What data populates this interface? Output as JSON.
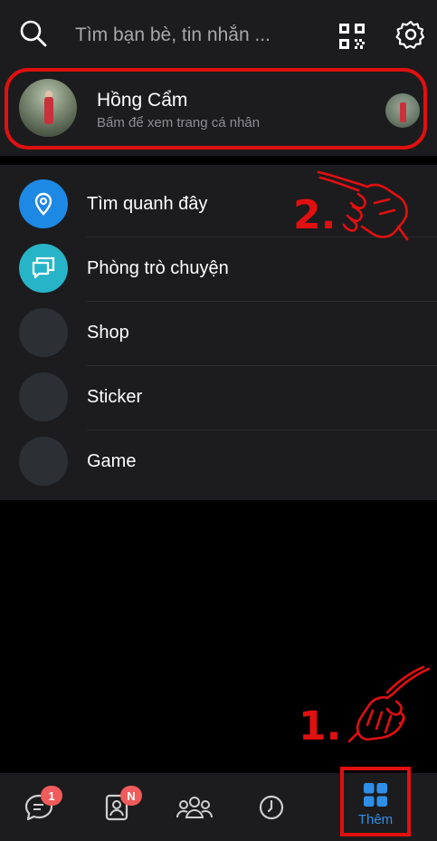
{
  "search": {
    "placeholder": "Tìm bạn bè, tin nhắn ..."
  },
  "profile": {
    "name": "Hồng Cẩm",
    "subtitle": "Bấm để xem trang cá nhân"
  },
  "menu": {
    "items": [
      {
        "label": "Tìm quanh đây",
        "icon": "location-pin-icon",
        "color": "#1e88e5"
      },
      {
        "label": "Phòng trò chuyện",
        "icon": "chat-rooms-icon",
        "color": "#28b4c8"
      },
      {
        "label": "Shop",
        "icon": "shop-icon",
        "color": "#2c3035"
      },
      {
        "label": "Sticker",
        "icon": "sticker-icon",
        "color": "#2c3035"
      },
      {
        "label": "Game",
        "icon": "game-icon",
        "color": "#2c3035"
      }
    ]
  },
  "annotations": {
    "step1": "1.",
    "step2": "2."
  },
  "bottom_nav": {
    "tabs": [
      {
        "name": "messages",
        "icon": "chat-bubble-icon",
        "badge": "1"
      },
      {
        "name": "contacts",
        "icon": "contact-card-icon",
        "badge": "N"
      },
      {
        "name": "groups",
        "icon": "group-icon"
      },
      {
        "name": "timeline",
        "icon": "clock-icon"
      },
      {
        "name": "more",
        "icon": "grid-icon",
        "label": "Thêm",
        "active": true
      }
    ]
  },
  "colors": {
    "accent": "#2f8fe8",
    "highlight": "#e01010",
    "surface": "#1c1c1e",
    "badge": "#f05b5b"
  }
}
